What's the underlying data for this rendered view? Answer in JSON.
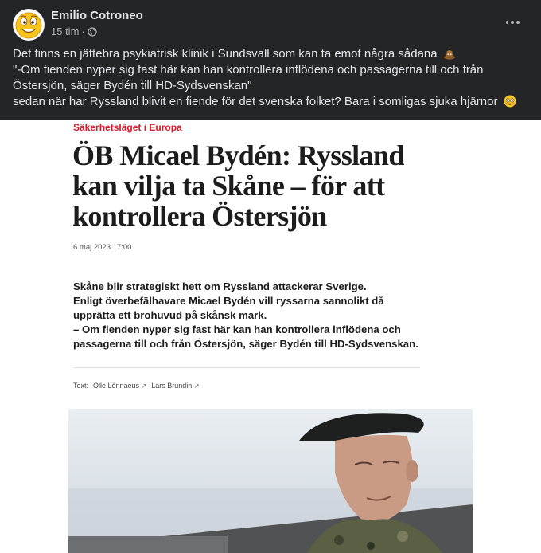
{
  "post": {
    "author": "Emilio Cotroneo",
    "time": "15 tim",
    "separator": "·",
    "text_lines": [
      "Det finns en jättebra psykiatrisk klinik i Sundsvall  som kan ta emot några sådana",
      "\"-Om fienden nyper sig fast här kan han kontrollera inflödena och passagerna till och från",
      "Östersjön, säger Bydén till HD-Sydsvenskan\"",
      "sedan när har Ryssland blivit en fiende för det svenska folket? Bara i somligas sjuka hjärnor"
    ],
    "icons": {
      "avatar": "smiley-emoji-avatar",
      "audience": "globe-icon",
      "more": "more-options-icon",
      "emoji_line1": "poop-emoji",
      "emoji_line4": "flushed-face-emoji"
    }
  },
  "article": {
    "kicker": "Säkerhetsläget i Europa",
    "headline_lines": [
      "ÖB Micael Bydén: Ryssland",
      "kan vilja ta Skåne – för att",
      "kontrollera Östersjön"
    ],
    "date": "6 maj 2023 17:00",
    "lead_lines": [
      "Skåne blir strategiskt hett om Ryssland attackerar Sverige.",
      "Enligt överbefälhavare Micael Bydén vill ryssarna sannolikt då",
      "upprätta ett brohuvud på skånsk mark.",
      "– Om fienden nyper sig fast här kan han kontrollera inflödena och",
      "passagerna till och från Östersjön, säger Bydén till HD-Sydsvenskan."
    ],
    "byline_label": "Text:",
    "authors": [
      "Olle Lönnaeus",
      "Lars Brundin"
    ],
    "external_mark": "↗",
    "kicker_color": "#d61a2a"
  }
}
